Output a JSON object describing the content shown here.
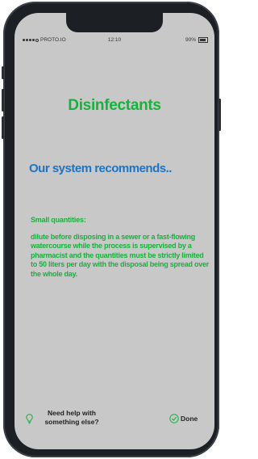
{
  "status_bar": {
    "carrier": "PROTO.IO",
    "time": "12:10",
    "battery": "90%"
  },
  "content": {
    "title": "Disinfectants",
    "subtitle": "Our system recommends..",
    "label": "Small quantities:",
    "body": "dilute before disposing in a sewer or a fast-flowing watercourse while the process is supervised by a pharmacist and the quantities must be strictly limited to 50 liters per day with the disposal being spread over the whole day."
  },
  "footer": {
    "help_label": "Need help with something else?",
    "done_label": "Done"
  },
  "colors": {
    "accent_green": "#18b13c",
    "accent_blue": "#1d74c4",
    "screen_bg": "#c8c8c8"
  },
  "icons": {
    "help": "lightbulb-icon",
    "done": "check-circle-icon"
  }
}
